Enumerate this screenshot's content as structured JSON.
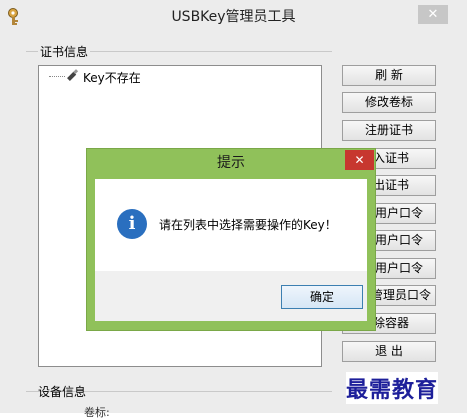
{
  "window": {
    "title": "USBKey管理员工具",
    "close_glyph": "✕",
    "icon": "usb-key-icon"
  },
  "cert_group": {
    "label": "证书信息",
    "tree_item": "Key不存在"
  },
  "side_buttons": [
    {
      "name": "refresh-button",
      "label": "刷  新"
    },
    {
      "name": "modify-label-button",
      "label": "修改卷标"
    },
    {
      "name": "register-cert-button",
      "label": "注册证书"
    },
    {
      "name": "import-cert-button",
      "label": "入证书"
    },
    {
      "name": "export-cert-button",
      "label": "出证书"
    },
    {
      "name": "user-pin-button-1",
      "label": "用户口令"
    },
    {
      "name": "user-pin-button-2",
      "label": "用户口令"
    },
    {
      "name": "user-pin-button-3",
      "label": "用户口令"
    },
    {
      "name": "admin-pin-button",
      "label": "管理员口令"
    },
    {
      "name": "delete-container-button",
      "label": "除容器"
    },
    {
      "name": "exit-button",
      "label": "退  出"
    }
  ],
  "device_group": {
    "label": "设备信息",
    "sub_label": "卷标:"
  },
  "dialog": {
    "title": "提示",
    "close_glyph": "✕",
    "message": "请在列表中选择需要操作的Key！",
    "icon_glyph": "i",
    "ok_label": "确定"
  },
  "watermark": "最需教育",
  "colors": {
    "dialog_frame": "#90c15a",
    "dialog_close": "#c7372f",
    "info_icon": "#2a6fbf",
    "watermark": "#1d1f9a"
  }
}
